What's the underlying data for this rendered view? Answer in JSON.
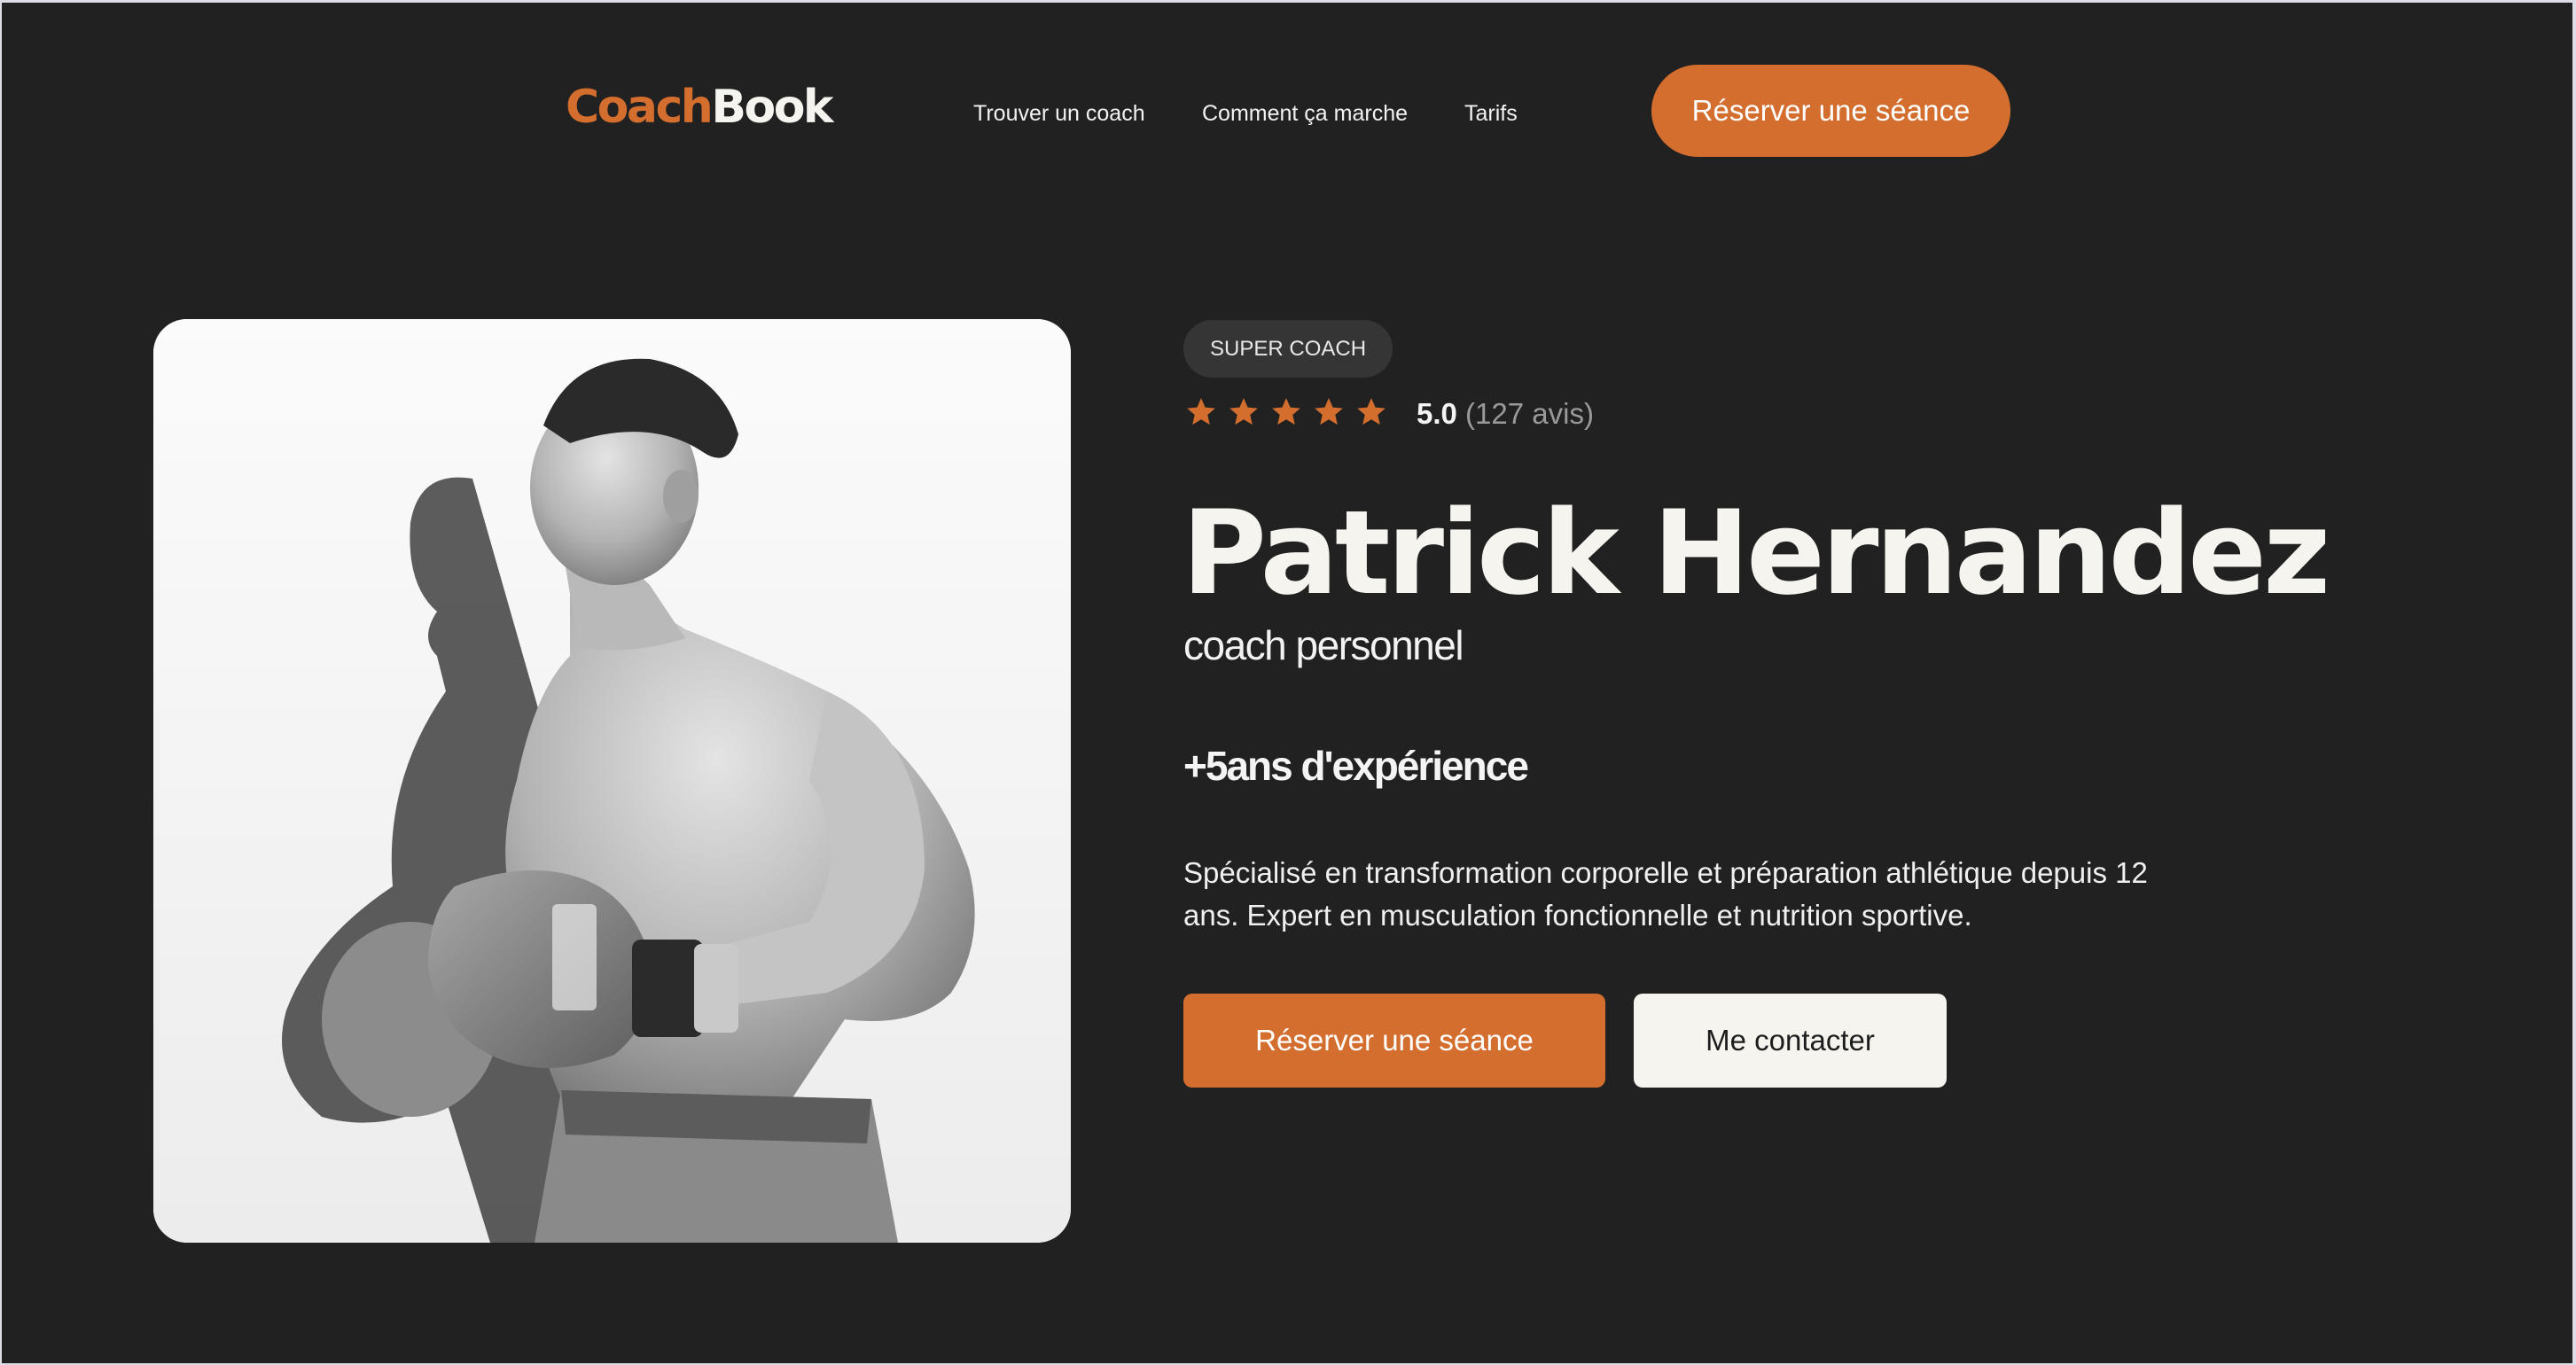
{
  "brand": {
    "part1": "Coach",
    "part2": "Book",
    "accent_color": "#d46e2e"
  },
  "nav": {
    "links": [
      "Trouver un coach",
      "Comment ça marche",
      "Tarifs"
    ],
    "cta_label": "Réserver une séance"
  },
  "coach": {
    "badge": "SUPER COACH",
    "rating": {
      "score": "5.0",
      "reviews": "(127 avis)",
      "stars": 5,
      "star_icon": "star-icon"
    },
    "name": "Patrick Hernandez",
    "role": "coach personnel",
    "experience": "+5ans d'expérience",
    "description": "Spécialisé en transformation corporelle et préparation athlétique depuis 12 ans. Expert en musculation fonctionnelle et nutrition sportive.",
    "photo_icon": "coach-photo"
  },
  "actions": {
    "primary_label": "Réserver une séance",
    "secondary_label": "Me contacter"
  },
  "colors": {
    "background": "#212121",
    "accent": "#d46e2e",
    "light": "#f6f4ef",
    "badge_bg": "#353535"
  }
}
